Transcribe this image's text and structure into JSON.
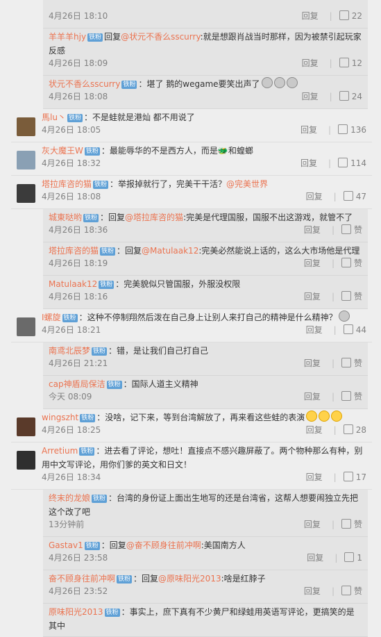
{
  "ui": {
    "reply": "回复",
    "like_icon": "thumb-up-icon",
    "verified_badge": "铁粉"
  },
  "comments": [
    {
      "kind": "sub-top",
      "text": "",
      "time": "4月26日 18:10",
      "likes": "22"
    },
    {
      "kind": "sub",
      "user": "羊羊羊hjy",
      "prefix": "回复",
      "mention": "@状元不香么sscurry",
      "body": ":就是想跟肖战当时那样，因为被禁引起玩家反感",
      "time": "4月26日 18:09",
      "likes": "12"
    },
    {
      "kind": "sub",
      "user": "状元不香么sscurry",
      "body": "：堪了 鹅的wegame要笑出声了",
      "emojis": 3,
      "time": "4月26日 18:08",
      "likes": "24"
    },
    {
      "kind": "top",
      "user": "馬lu丶",
      "body": "：不是蛙就是港灿 都不用说了",
      "time": "4月26日 18:05",
      "likes": "136"
    },
    {
      "kind": "top",
      "user": "灰大魔王W",
      "body": "：最能辱华的不是西方人，而是🐲和蝗螂",
      "time": "4月26日 18:32",
      "likes": "114"
    },
    {
      "kind": "top",
      "user": "塔拉库咨的猫",
      "body": "：举报掉就行了，完美干干活？",
      "mention": "@完美世界",
      "time": "4月26日 18:08",
      "likes": "47"
    },
    {
      "kind": "sub",
      "user": "城東哒哟",
      "prefix": "：回复",
      "mention": "@塔拉库咨的猫",
      "body": ":完美是代理国服，国服不出这游戏，就管不了",
      "time": "4月26日 18:36",
      "likes": "赞"
    },
    {
      "kind": "sub",
      "user": "塔拉库咨的猫",
      "prefix": "：回复",
      "mention": "@Matulaak12",
      "body": ":完美必然能说上话的，这么大市场他是代理",
      "time": "4月26日 18:19",
      "likes": "赞"
    },
    {
      "kind": "sub",
      "user": "Matulaak12",
      "body": "：完美貌似只管国服，外服没权限",
      "time": "4月26日 18:16",
      "likes": "赞"
    },
    {
      "kind": "top",
      "user": "I螺旋",
      "body": "：这种不停制翔然后泼在自己身上让别人来打自己的精神是什么精神？",
      "emojis": 1,
      "time": "4月26日 18:21",
      "likes": "44"
    },
    {
      "kind": "sub",
      "user": "南鸢北辰梦",
      "body": "：错，是让我们自己打自己",
      "time": "4月26日 21:21",
      "likes": "赞"
    },
    {
      "kind": "sub",
      "user": "cap神盾局保洁",
      "body": "：国际人道主义精神",
      "time": "今天 08:09",
      "likes": "赞"
    },
    {
      "kind": "top",
      "user": "wingszht",
      "body": "：没啥，记下来，等到台湾解放了，再来看这些蛙的表演",
      "emojis": 3,
      "time": "4月26日 18:25",
      "likes": "28"
    },
    {
      "kind": "top",
      "user": "Arretium",
      "body": "：进去看了评论，想吐！直接点不感兴趣屏蔽了。两个物种那么有种，别用中文写评论，用你们爹的英文和日文！",
      "time": "4月26日 18:34",
      "likes": "17"
    },
    {
      "kind": "sub",
      "user": "终末的龙娘",
      "body": "：台湾的身份证上面出生地写的还是台湾省，这帮人想要闹独立先把这个改了吧",
      "time": "13分钟前",
      "likes": "赞"
    },
    {
      "kind": "sub",
      "user": "Gastav1",
      "prefix": "：回复",
      "mention": "@奋不顾身往前冲啊",
      "body": ":美国南方人",
      "time": "4月26日 23:58",
      "likes": "1"
    },
    {
      "kind": "sub",
      "user": "奋不顾身往前冲啊",
      "prefix": "：回复",
      "mention": "@原味阳光2013",
      "body": ":啥是红脖子",
      "time": "4月26日 23:52",
      "likes": "赞"
    },
    {
      "kind": "sub",
      "user": "原味阳光2013",
      "body": "：事实上，庶下真有不少黄尸和绿蛙用英语写评论，更搞笑的是其中",
      "time": "",
      "likes": ""
    }
  ]
}
